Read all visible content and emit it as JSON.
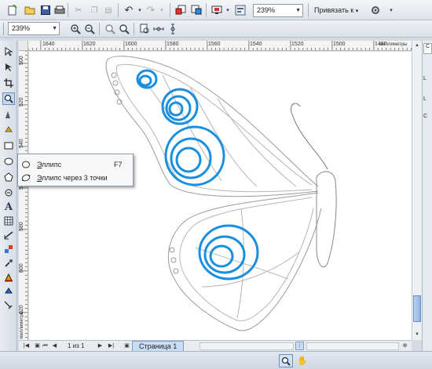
{
  "toolbar": {
    "zoom_value": "239%",
    "snap_label": "Привязать к",
    "zoom_value_2": "239%"
  },
  "rulers": {
    "unit": "миллиметры",
    "h_labels": [
      "1640",
      "1620",
      "1600",
      "1580",
      "1560",
      "1540",
      "1520",
      "1500",
      "1480"
    ],
    "v_labels": [
      "500",
      "520",
      "540",
      "560",
      "580",
      "600",
      "620"
    ]
  },
  "flyout": {
    "items": [
      {
        "label_prefix": "Э",
        "label_rest": "ллипс",
        "shortcut": "F7"
      },
      {
        "label_prefix": "Э",
        "label_rest": "ллипс через 3 точки",
        "shortcut": ""
      }
    ]
  },
  "pagebar": {
    "page_count": "1 из 1",
    "page_tab": "Страница 1"
  },
  "docker": {
    "tab_letter": "С",
    "labels": [
      "L",
      "L",
      "С"
    ]
  },
  "colors": {
    "accent_blue": "#1a8fe0",
    "outline_gray": "#9a9a9a"
  }
}
